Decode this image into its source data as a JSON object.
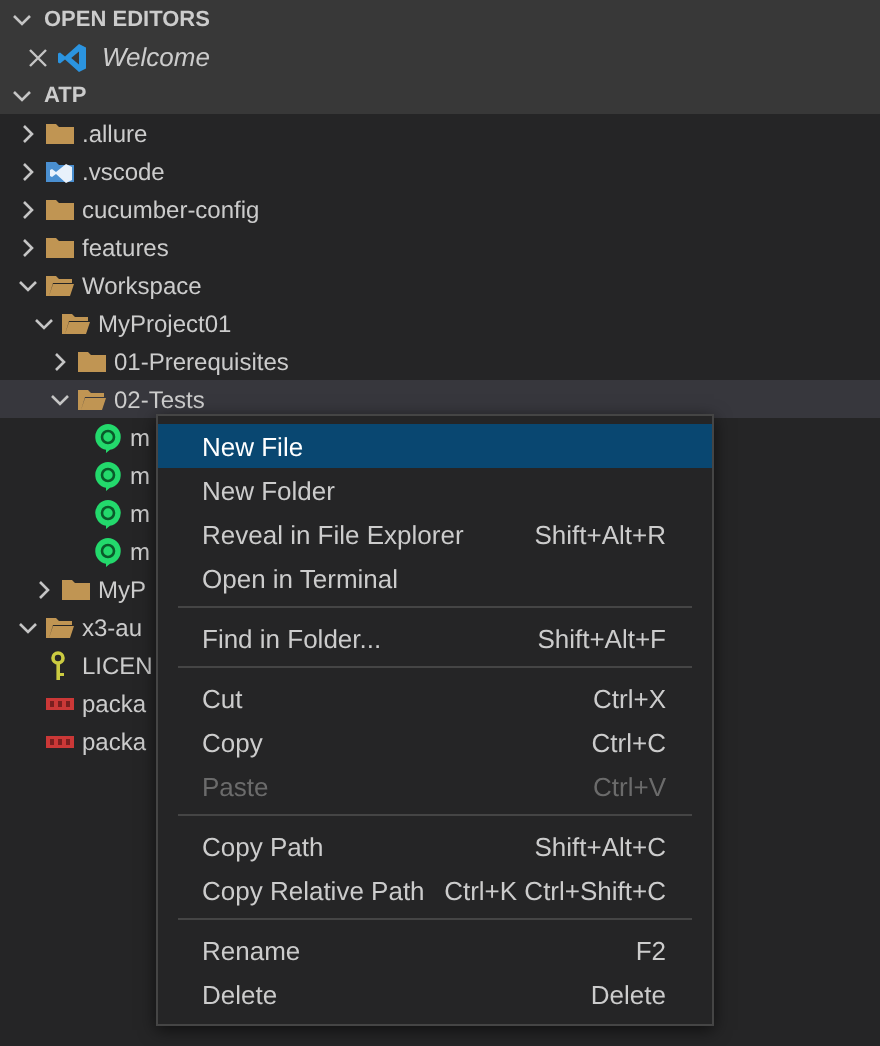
{
  "sections": [
    {
      "title": "OPEN EDITORS",
      "expanded": true
    },
    {
      "title": "ATP",
      "expanded": true
    }
  ],
  "open_editors": [
    {
      "label": "Welcome",
      "kind": "welcome"
    }
  ],
  "tree": [
    {
      "label": ".allure",
      "kind": "folder",
      "expanded": false,
      "selected": false
    },
    {
      "label": ".vscode",
      "kind": "vscode-folder",
      "expanded": false,
      "selected": false
    },
    {
      "label": "cucumber-config",
      "kind": "folder",
      "expanded": false,
      "selected": false
    },
    {
      "label": "features",
      "kind": "folder",
      "expanded": false,
      "selected": false
    },
    {
      "label": "Workspace",
      "kind": "folder",
      "expanded": true,
      "selected": false,
      "children": [
        {
          "label": "MyProject01",
          "kind": "folder",
          "expanded": true,
          "selected": false,
          "children": [
            {
              "label": "01-Prerequisites",
              "kind": "folder",
              "expanded": false,
              "selected": false
            },
            {
              "label": "02-Tests",
              "kind": "folder",
              "expanded": true,
              "selected": true,
              "children": [
                {
                  "label": "m",
                  "kind": "cucumber",
                  "selected": false
                },
                {
                  "label": "m",
                  "kind": "cucumber",
                  "selected": false
                },
                {
                  "label": "m",
                  "kind": "cucumber",
                  "selected": false
                },
                {
                  "label": "m",
                  "kind": "cucumber",
                  "selected": false
                }
              ]
            }
          ]
        },
        {
          "label": "MyP",
          "kind": "folder",
          "expanded": false,
          "selected": false
        }
      ]
    },
    {
      "label": "x3-au",
      "kind": "folder",
      "expanded": true,
      "selected": false
    },
    {
      "label": "LICEN",
      "kind": "license",
      "selected": false
    },
    {
      "label": "packa",
      "kind": "npm",
      "selected": false
    },
    {
      "label": "packa",
      "kind": "npm",
      "selected": false
    }
  ],
  "context_menu": [
    {
      "kind": "item",
      "label": "New File",
      "selected": true,
      "disabled": false
    },
    {
      "kind": "item",
      "label": "New Folder",
      "selected": false,
      "disabled": false
    },
    {
      "kind": "item",
      "label": "Reveal in File Explorer",
      "shortcut": "Shift+Alt+R",
      "selected": false,
      "disabled": false
    },
    {
      "kind": "item",
      "label": "Open in Terminal",
      "selected": false,
      "disabled": false
    },
    {
      "kind": "separator"
    },
    {
      "kind": "item",
      "label": "Find in Folder...",
      "shortcut": "Shift+Alt+F",
      "selected": false,
      "disabled": false
    },
    {
      "kind": "separator"
    },
    {
      "kind": "item",
      "label": "Cut",
      "shortcut": "Ctrl+X",
      "selected": false,
      "disabled": false
    },
    {
      "kind": "item",
      "label": "Copy",
      "shortcut": "Ctrl+C",
      "selected": false,
      "disabled": false
    },
    {
      "kind": "item",
      "label": "Paste",
      "shortcut": "Ctrl+V",
      "selected": false,
      "disabled": true
    },
    {
      "kind": "separator"
    },
    {
      "kind": "item",
      "label": "Copy Path",
      "shortcut": "Shift+Alt+C",
      "selected": false,
      "disabled": false
    },
    {
      "kind": "item",
      "label": "Copy Relative Path",
      "shortcut": "Ctrl+K Ctrl+Shift+C",
      "selected": false,
      "disabled": false
    },
    {
      "kind": "separator"
    },
    {
      "kind": "item",
      "label": "Rename",
      "shortcut": "F2",
      "selected": false,
      "disabled": false
    },
    {
      "kind": "item",
      "label": "Delete",
      "shortcut": "Delete",
      "selected": false,
      "disabled": false
    }
  ]
}
